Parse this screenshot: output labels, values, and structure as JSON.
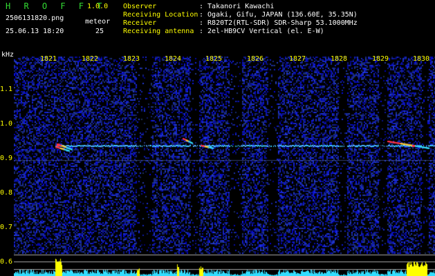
{
  "header": {
    "app_name": "H R O F F T",
    "version": "1.0.0",
    "filename": "2506131820.png",
    "datetime": "25.06.13 18:20",
    "meteor_label": "meteor",
    "meteor_count": "25"
  },
  "info": {
    "labels": [
      "Observer",
      "Receiving Location",
      "Receiver",
      "Receiving antenna"
    ],
    "values": [
      ": Takanori Kawachi",
      ": Ogaki, Gifu, JAPAN (136.60E, 35.35N)",
      ": R820T2(RTL-SDR) SDR-Sharp 53.1000MHz",
      ": 2el-HB9CV Vertical (el. E-W)"
    ]
  },
  "axis": {
    "unit_label": "kHz",
    "minutes": [
      "1821",
      "1822",
      "1823",
      "1824",
      "1825",
      "1826",
      "1827",
      "1828",
      "1829",
      "1830"
    ],
    "freq_ticks": [
      "1.1",
      "1.0",
      "0.9",
      "0.8",
      "0.7",
      "0.6"
    ]
  },
  "colors": {
    "background": "#000000",
    "header_green": "#33dd33",
    "header_yellow": "#ffff00",
    "noise_blue": "#2a3aa0",
    "signal_cyan": "#33ccff",
    "meteor_red": "#ff3344",
    "power_cyan": "#33ddff",
    "power_yellow": "#ffff00"
  }
}
